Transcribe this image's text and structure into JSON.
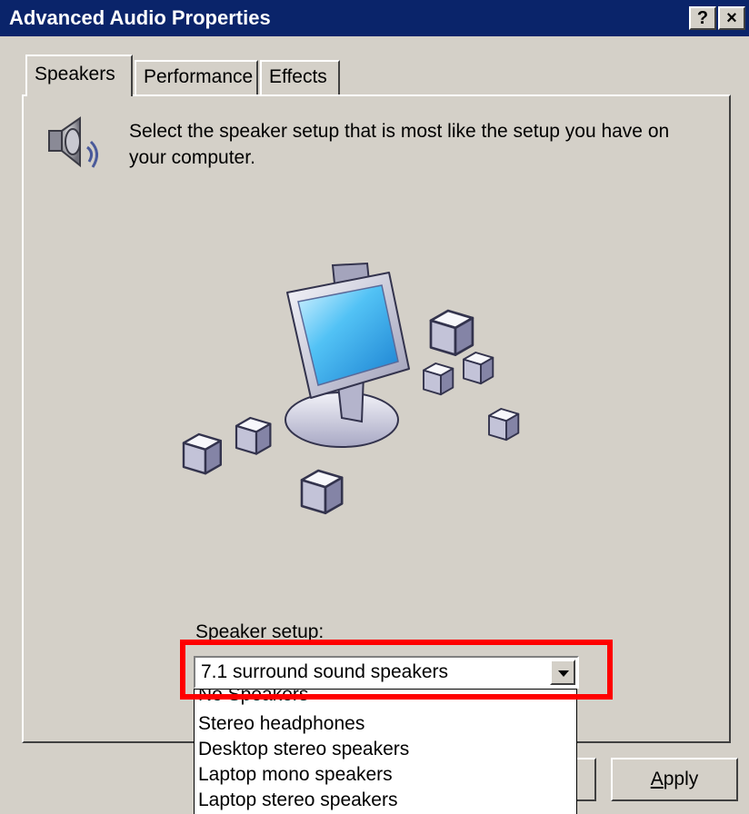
{
  "window": {
    "title": "Advanced Audio Properties",
    "help_button": "?",
    "close_button": "×"
  },
  "tabs": [
    {
      "label": "Speakers",
      "active": true
    },
    {
      "label": "Performance",
      "active": false
    },
    {
      "label": "Effects",
      "active": false
    }
  ],
  "speakers_tab": {
    "instruction": "Select the speaker setup that is most like the setup you have on your computer.",
    "icon": "speaker-icon",
    "diagram": "7.1-surround-computer-diagram-icon",
    "setup_label": "Speaker setup:",
    "setup_selected": "7.1 surround sound speakers",
    "dropdown_options": [
      "No Speakers",
      "Stereo headphones",
      "Desktop stereo speakers",
      "Laptop mono speakers",
      "Laptop stereo speakers"
    ],
    "highlight_color": "#ff0000"
  },
  "buttons": {
    "apply_prefix": "A",
    "apply_rest": "pply"
  },
  "colors": {
    "titlebar": "#0a246a",
    "face": "#d4d0c8",
    "highlight": "#ff0000"
  }
}
